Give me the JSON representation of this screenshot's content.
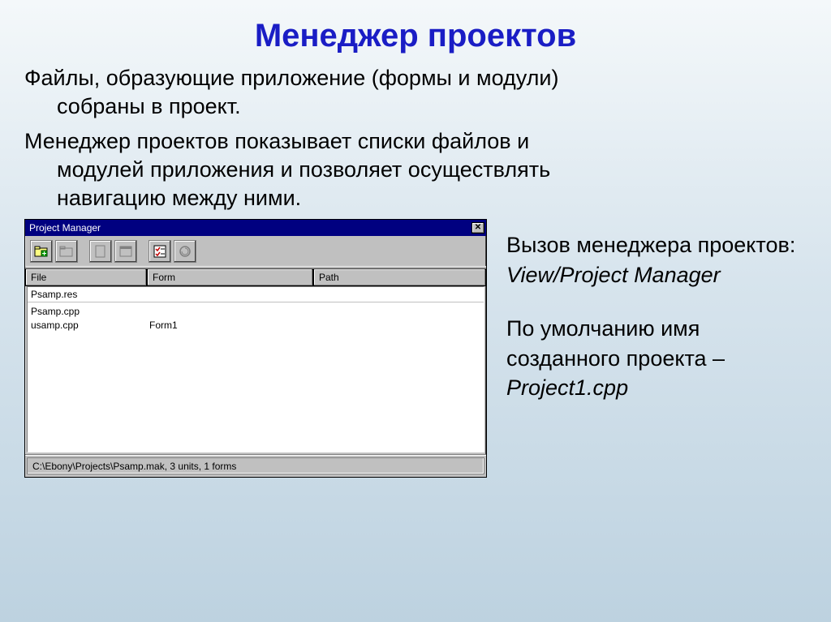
{
  "slide": {
    "title": "Менеджер проектов",
    "para1_line1": "Файлы, образующие приложение (формы и модули)",
    "para1_line2": "собраны в проект.",
    "para2_line1": "Менеджер проектов показывает списки файлов и",
    "para2_line2": "модулей приложения и позволяет осуществлять",
    "para2_line3": "навигацию между ними."
  },
  "side": {
    "call_label": "Вызов менеджера проектов:",
    "call_menu": "View/Project Manager",
    "default_label1": "По умолчанию имя",
    "default_label2": "созданного проекта –",
    "default_name": "Project1.cpp"
  },
  "pm": {
    "title": "Project Manager",
    "close": "✕",
    "columns": {
      "file": "File",
      "form": "Form",
      "path": "Path"
    },
    "rows": [
      {
        "file": "Psamp.res",
        "form": "",
        "path": ""
      },
      {
        "file": "Psamp.cpp",
        "form": "",
        "path": ""
      },
      {
        "file": "usamp.cpp",
        "form": "Form1",
        "path": ""
      }
    ],
    "status": "C:\\Ebony\\Projects\\Psamp.mak, 3 units, 1 forms",
    "toolbar": {
      "add": "add-unit",
      "remove": "remove-unit",
      "view_unit": "view-unit",
      "view_form": "view-form",
      "options": "options",
      "update": "update"
    }
  }
}
